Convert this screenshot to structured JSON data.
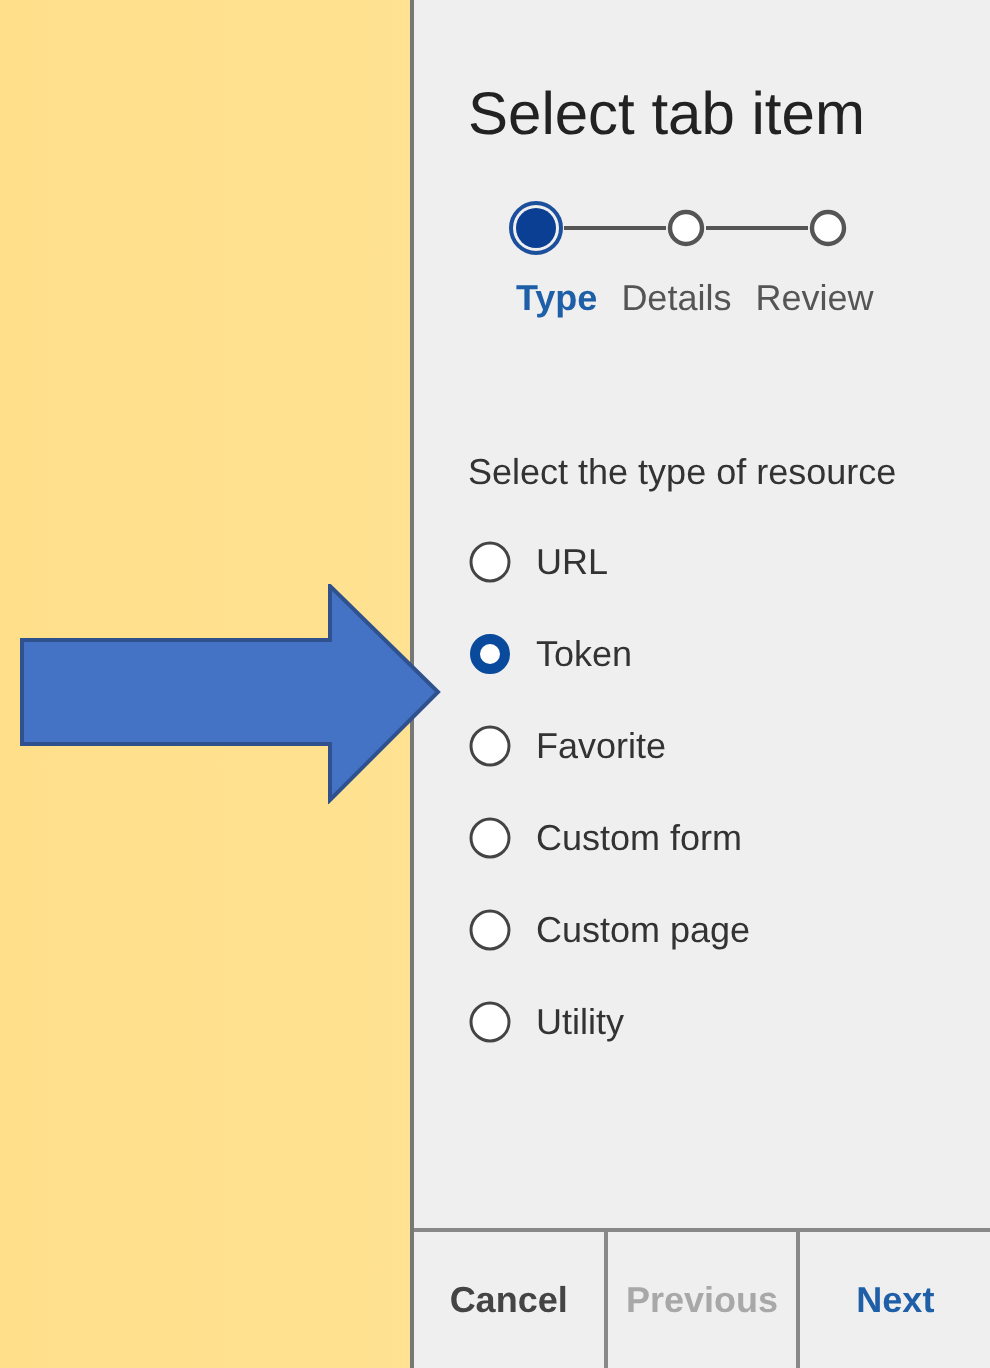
{
  "panel": {
    "title": "Select tab item"
  },
  "steps": [
    {
      "label": "Type",
      "selected": true
    },
    {
      "label": "Details",
      "selected": false
    },
    {
      "label": "Review",
      "selected": false
    }
  ],
  "prompt": "Select the type of resource",
  "options": [
    {
      "label": "URL",
      "selected": false
    },
    {
      "label": "Token",
      "selected": true
    },
    {
      "label": "Favorite",
      "selected": false
    },
    {
      "label": "Custom form",
      "selected": false
    },
    {
      "label": "Custom page",
      "selected": false
    },
    {
      "label": "Utility",
      "selected": false
    }
  ],
  "buttons": [
    {
      "label": "Cancel",
      "kind": "cancel",
      "disabled": false
    },
    {
      "label": "Previous",
      "kind": "back",
      "disabled": true
    },
    {
      "label": "Next",
      "kind": "primary",
      "disabled": false
    }
  ]
}
